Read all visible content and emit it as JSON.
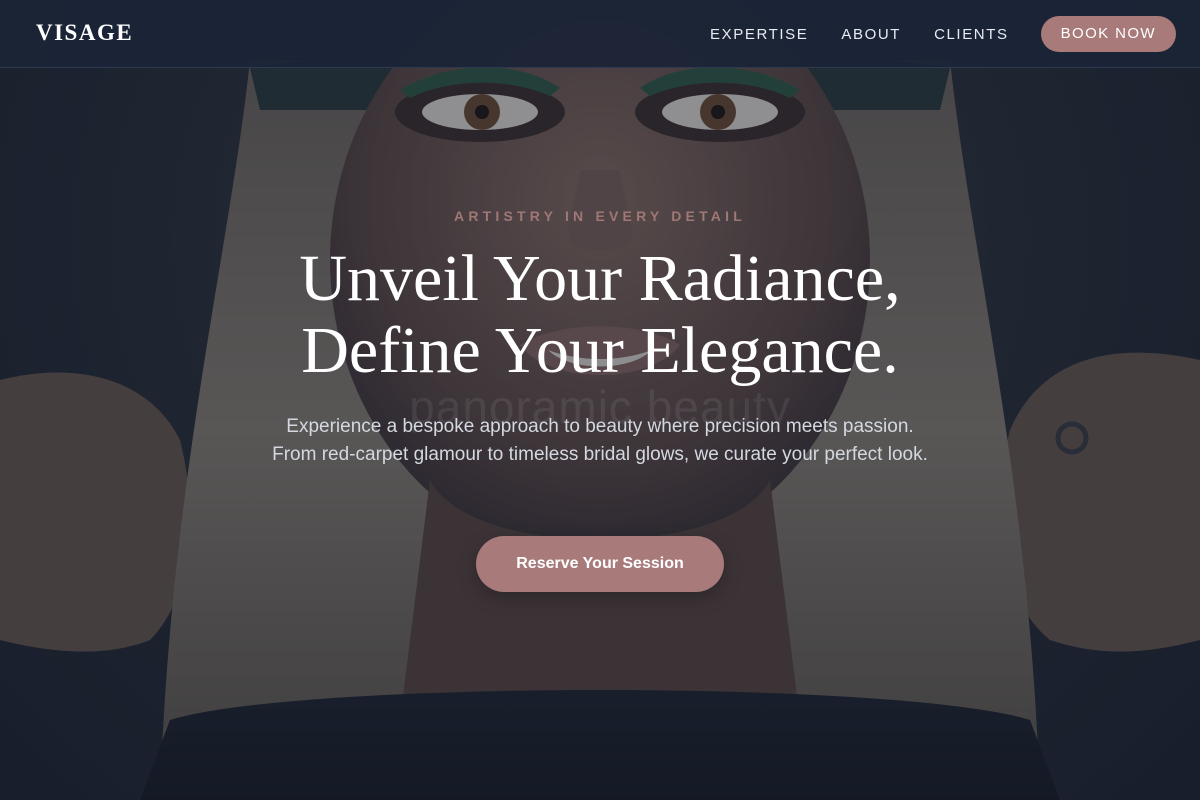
{
  "brand": {
    "logo": "VISAGE"
  },
  "nav": {
    "items": [
      {
        "label": "EXPERTISE"
      },
      {
        "label": "ABOUT"
      },
      {
        "label": "CLIENTS"
      }
    ],
    "cta_label": "BOOK NOW"
  },
  "hero": {
    "eyebrow": "ARTISTRY IN EVERY DETAIL",
    "headline_line1": "Unveil Your Radiance,",
    "headline_line2": "Define Your Elegance.",
    "watermark": "panoramic beauty",
    "lead": "Experience a bespoke approach to beauty where precision meets passion. From red-carpet glamour to timeless bridal glows, we curate your perfect look.",
    "cta_label": "Reserve Your Session"
  },
  "colors": {
    "nav_bg": "#1b2436",
    "accent": "#a87a7a",
    "eyebrow": "#a07777",
    "text_primary": "#ffffff",
    "text_secondary": "#d4d8e0"
  }
}
